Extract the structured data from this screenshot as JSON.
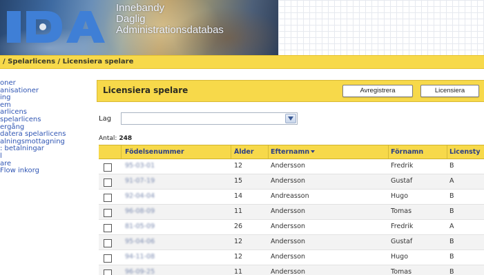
{
  "banner": {
    "logo_text": "IDA",
    "title_lines": [
      "Innebandy",
      "Daglig",
      "Administrationsdatabas"
    ],
    "colors": {
      "logo": "#3f7fd6",
      "accent": "#f7d94a"
    }
  },
  "breadcrumb": "/ Spelarlicens / Licensiera spelare",
  "nav": {
    "items": [
      "oner",
      "anisationer",
      "ing",
      "em",
      "arlicens",
      "spelarlicens",
      "ergång",
      "datera spelarlicens",
      "alningsmottagning",
      ": betalningar",
      "l",
      "are",
      "Flow inkorg"
    ]
  },
  "panel": {
    "title": "Licensiera spelare",
    "buttons": {
      "deregister": "Avregistrera",
      "license": "Licensiera"
    }
  },
  "filter": {
    "label": "Lag",
    "value": "",
    "arrow_icon": "chevron-down-icon"
  },
  "count": {
    "label": "Antal:",
    "value": "248"
  },
  "table": {
    "columns": {
      "birth": "Födelsenummer",
      "age": "Ålder",
      "last": "Efternamn",
      "first": "Förnamn",
      "lic": "Licensty"
    },
    "sorted_column": "last",
    "rows": [
      {
        "birth": "95-03-01",
        "age": "12",
        "last": "Andersson",
        "first": "Fredrik",
        "lic": "B"
      },
      {
        "birth": "91-07-19",
        "age": "15",
        "last": "Andersson",
        "first": "Gustaf",
        "lic": "A"
      },
      {
        "birth": "92-04-04",
        "age": "14",
        "last": "Andreasson",
        "first": "Hugo",
        "lic": "B"
      },
      {
        "birth": "96-08-09",
        "age": "11",
        "last": "Andersson",
        "first": "Tomas",
        "lic": "B"
      },
      {
        "birth": "81-05-09",
        "age": "26",
        "last": "Andersson",
        "first": "Fredrik",
        "lic": "A"
      },
      {
        "birth": "95-04-06",
        "age": "12",
        "last": "Andersson",
        "first": "Gustaf",
        "lic": "B"
      },
      {
        "birth": "94-11-08",
        "age": "12",
        "last": "Andersson",
        "first": "Hugo",
        "lic": "B"
      },
      {
        "birth": "96-09-25",
        "age": "11",
        "last": "Andersson",
        "first": "Tomas",
        "lic": "B"
      }
    ]
  }
}
